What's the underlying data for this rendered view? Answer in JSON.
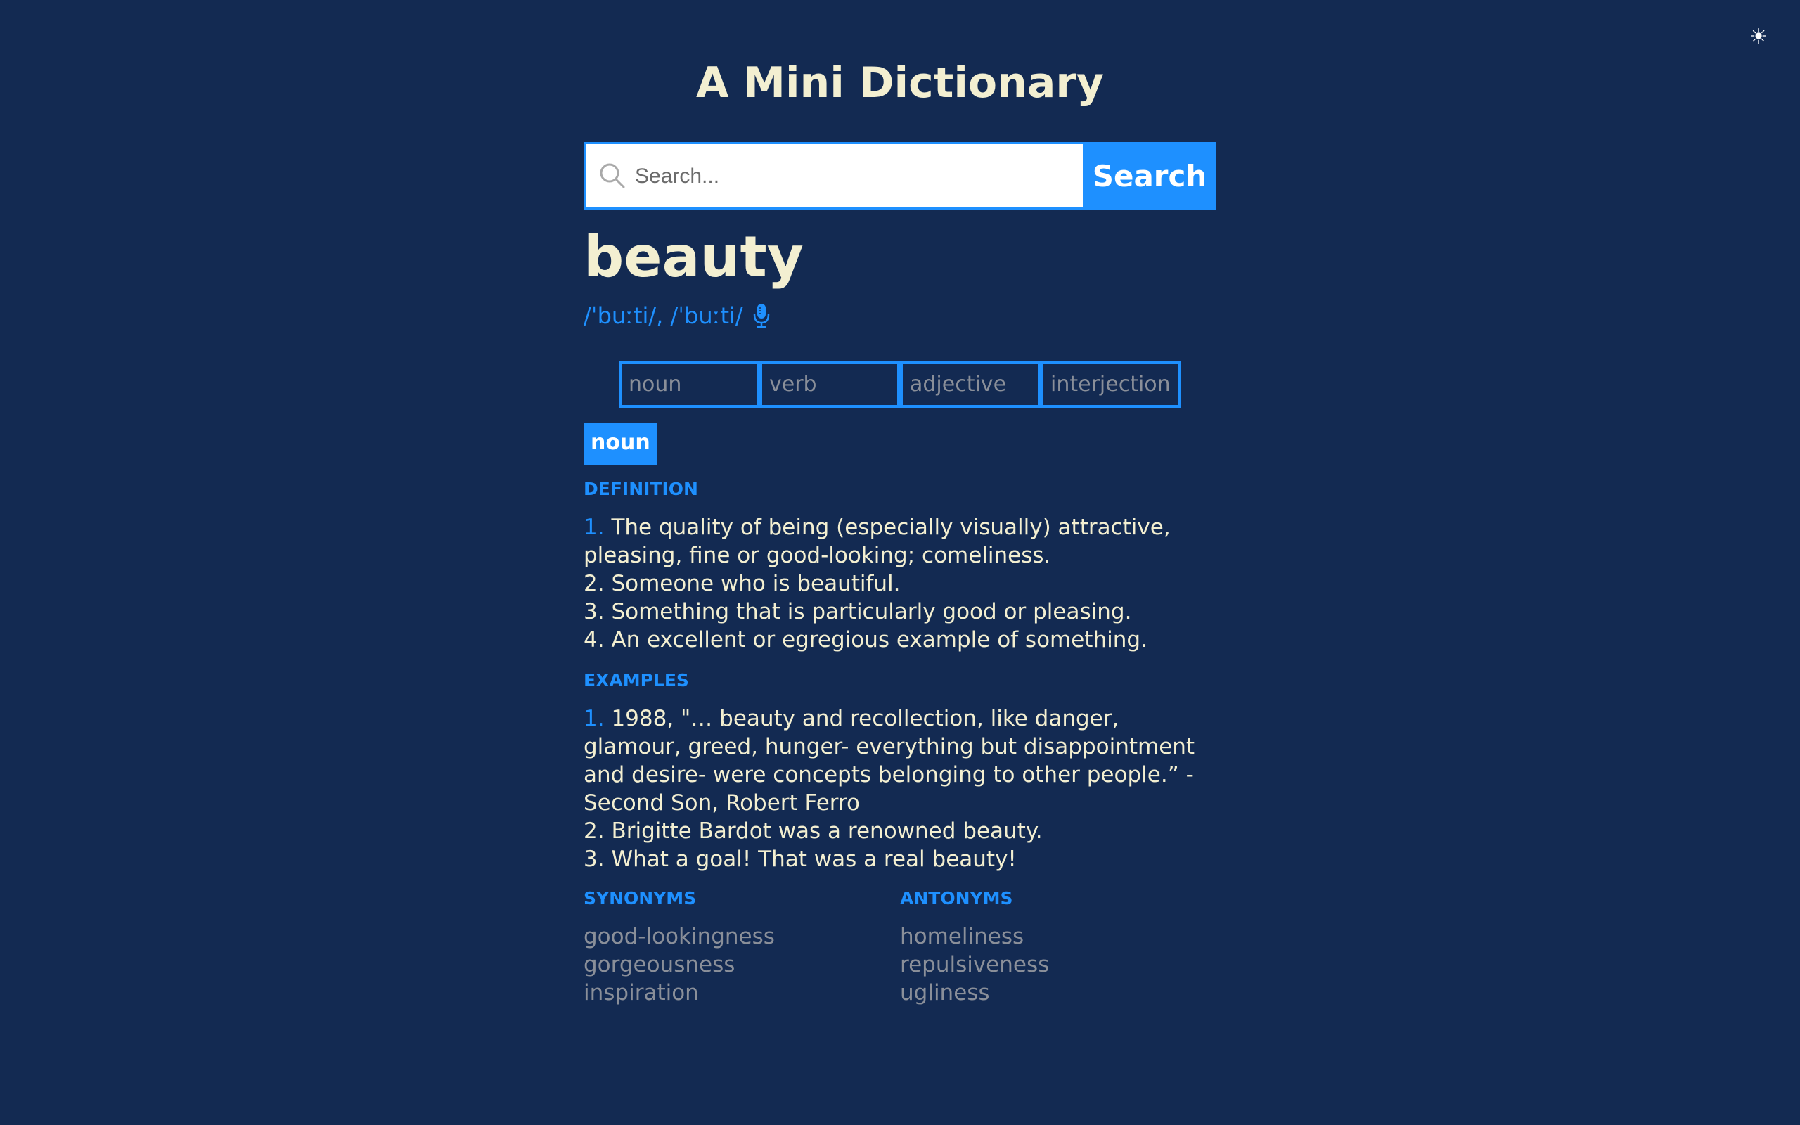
{
  "app": {
    "title": "A Mini Dictionary",
    "theme_icon": "sun-icon"
  },
  "search": {
    "placeholder": "Search...",
    "value": "",
    "button_label": "Search",
    "icon": "search-icon"
  },
  "entry": {
    "word": "beauty",
    "phonetics": "/ˈbuːti/, /ˈbuːti/",
    "audio_icon": "microphone-icon",
    "parts_of_speech": [
      "noun",
      "verb",
      "adjective",
      "interjection"
    ],
    "active_part_of_speech": "noun",
    "definition_heading": "DEFINITION",
    "definitions": [
      {
        "num": "1.",
        "text": "The quality of being (especially visually) attractive, pleasing, fine or good-looking; comeliness."
      },
      {
        "num": "2.",
        "text": "Someone who is beautiful."
      },
      {
        "num": "3.",
        "text": "Something that is particularly good or pleasing."
      },
      {
        "num": "4.",
        "text": "An excellent or egregious example of something."
      }
    ],
    "examples_heading": "EXAMPLES",
    "examples": [
      {
        "num": "1.",
        "text": "1988, \"… beauty and recollection, like danger, glamour, greed, hunger- everything but disappointment and desire- were concepts belonging to other people.” -Second Son, Robert Ferro"
      },
      {
        "num": "2.",
        "text": "Brigitte Bardot was a renowned beauty."
      },
      {
        "num": "3.",
        "text": "What a goal! That was a real beauty!"
      }
    ],
    "synonyms_heading": "SYNONYMS",
    "synonyms": [
      "good-lookingness",
      "gorgeousness",
      "inspiration"
    ],
    "antonyms_heading": "ANTONYMS",
    "antonyms": [
      "homeliness",
      "repulsiveness",
      "ugliness"
    ]
  },
  "colors": {
    "background": "#132a52",
    "accent": "#1e90ff",
    "text": "#f3efd1",
    "muted": "#8a8f99"
  }
}
